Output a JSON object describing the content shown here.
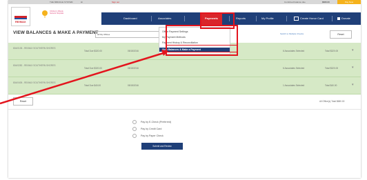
{
  "topbar": {
    "system_name": "THE MIRACLE SYSTEM",
    "user_label": "Hi",
    "sign_out": "Sign out",
    "balance_label": "Combined balance due",
    "balance_value": "$680.00",
    "pay_now": "Pay Now"
  },
  "header": {
    "remax_logo": "RE/MAX",
    "cmn_logo": "Children's Miracle Network Hospitals"
  },
  "nav": {
    "dashboard": "Dashboard",
    "associates": "Associates",
    "payments": "Payments",
    "reports": "Reports",
    "my_profile": "My Profile",
    "create_honor_card": "Create Honor Card",
    "donate": "Donate"
  },
  "dropdown": {
    "items": [
      "Office Payment Settings",
      "My Payment Methods",
      "Payment History & Reconciliation",
      "View Balances & Make a Payment"
    ]
  },
  "page": {
    "title": "VIEW BALANCES & MAKE A PAYMENT",
    "office_filter": "All My Offices",
    "switch_link": "Switch to Multiple Checks",
    "reset": "Reset"
  },
  "rows": [
    {
      "name": "804/0135 - RE/MAX SOUTHERN SHORES",
      "total_due": "Total Due $320.00",
      "date": "05/18/2016",
      "associates": "6 Associates Selected",
      "total": "Total $320.00"
    },
    {
      "name": "804/0282 - RE/MAX SOUTHERN SHORES",
      "total_due": "Total Due $320.00",
      "date": "05/18/2016",
      "associates": "6 Associates Selected",
      "total": "Total $320.00"
    },
    {
      "name": "804/0405 - RE/MAX SOUTHERN SHORES",
      "total_due": "Total Due $40.00",
      "date": "05/18/2016",
      "associates": "1 Associates Selected",
      "total": "Total $40.00"
    }
  ],
  "footer": {
    "reset": "Reset",
    "all_offices_total": "All Office(s) Total $680.00"
  },
  "payment_options": {
    "echeck": "Pay by E-Check (Preferred)",
    "credit": "Pay by Credit Card",
    "paper": "Pay by Paper Check",
    "submit": "Submit and Review"
  },
  "colors": {
    "navy": "#1f3f78",
    "highlight_red": "#e3141d",
    "row_green": "#d6e9c6",
    "gold": "#f5b21c"
  }
}
